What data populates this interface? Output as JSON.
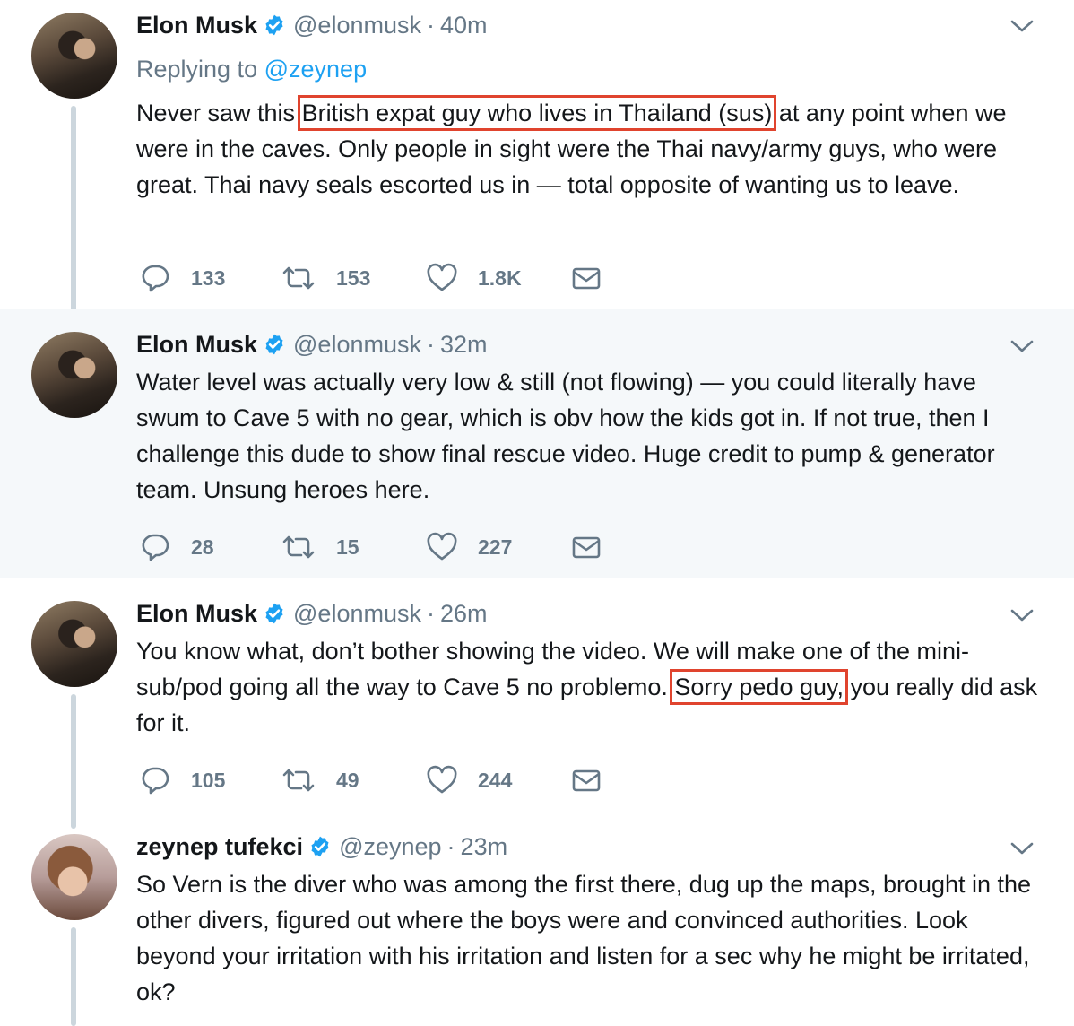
{
  "tweets": [
    {
      "name": "Elon Musk",
      "handle": "@elonmusk",
      "separator": "·",
      "time": "40m",
      "replying_prefix": "Replying to",
      "replying_mention": "@zeynep",
      "text_before": "Never saw this ",
      "text_highlight": "British expat guy who lives in Thailand (sus)",
      "text_after": " at any point when we were in the caves. Only people in sight were the Thai navy/army guys, who were great. Thai navy seals escorted us in — total opposite of wanting us to leave.",
      "replies": "133",
      "retweets": "153",
      "likes": "1.8K"
    },
    {
      "name": "Elon Musk",
      "handle": "@elonmusk",
      "separator": "·",
      "time": "32m",
      "text": "Water level was actually very low & still (not flowing) — you could literally have swum to Cave 5 with no gear, which is obv how the kids got in. If not true, then I challenge this dude to show final rescue video. Huge credit to pump & generator team. Unsung heroes here.",
      "replies": "28",
      "retweets": "15",
      "likes": "227"
    },
    {
      "name": "Elon Musk",
      "handle": "@elonmusk",
      "separator": "·",
      "time": "26m",
      "text_before": "You know what, don’t bother showing the video. We will make one of the mini-sub/pod going all the way to Cave 5 no problemo. ",
      "text_highlight": "Sorry pedo guy,",
      "text_after": " you really did ask for it.",
      "replies": "105",
      "retweets": "49",
      "likes": "244"
    },
    {
      "name": "zeynep tufekci",
      "handle": "@zeynep",
      "separator": "·",
      "time": "23m",
      "text": "So Vern is the diver who was among the first there, dug up the maps, brought in the other divers, figured out where the boys were and convinced authorities. Look beyond your irritation with his irritation and listen for a sec why he might be irritated, ok?"
    }
  ],
  "icons": {
    "reply": "reply-bubble-icon",
    "retweet": "retweet-arrows-icon",
    "like": "heart-icon",
    "dm": "envelope-icon",
    "verified": "verified-badge-icon",
    "menu": "chevron-down-icon"
  },
  "colors": {
    "link": "#1da1f2",
    "muted": "#657786",
    "highlight_box": "#e0442e",
    "thread_line": "#ccd6dd",
    "shaded_bg": "#f5f8fa"
  }
}
